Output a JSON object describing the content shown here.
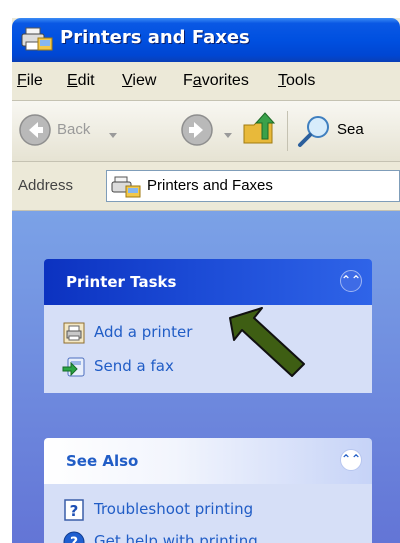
{
  "window": {
    "title": "Printers and Faxes"
  },
  "menu": {
    "items": [
      "File",
      "Edit",
      "View",
      "Favorites",
      "Tools"
    ],
    "accelerators": [
      "F",
      "E",
      "V",
      "a",
      "T"
    ]
  },
  "toolbar": {
    "back_label": "Back",
    "search_label": "Sea"
  },
  "address": {
    "label": "Address",
    "value": "Printers and Faxes"
  },
  "printer_tasks": {
    "title": "Printer Tasks",
    "items": [
      {
        "label": "Add a printer",
        "icon": "add-printer-icon"
      },
      {
        "label": "Send a fax",
        "icon": "send-fax-icon"
      }
    ]
  },
  "see_also": {
    "title": "See Also",
    "items": [
      {
        "label": "Troubleshoot printing",
        "icon": "help-document-icon"
      },
      {
        "label": "Get help with printing",
        "icon": "help-circle-icon"
      }
    ]
  },
  "colors": {
    "title_bar": "#0050e0",
    "task_pane": "#7ba2e7",
    "task_link": "#215dc6",
    "annotation_arrow": "#3e5e13"
  }
}
